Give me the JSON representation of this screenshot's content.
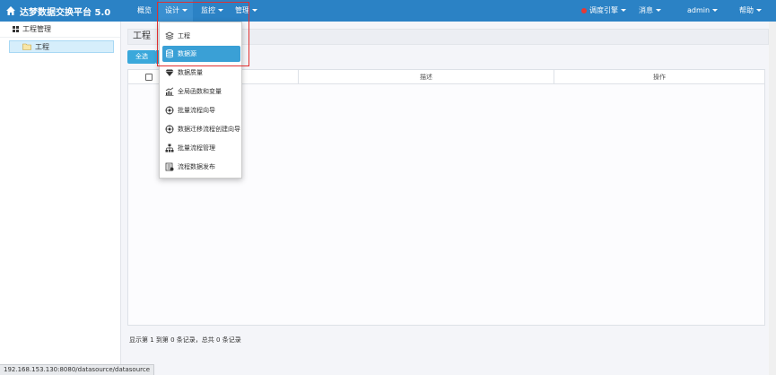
{
  "app": {
    "title": "达梦数据交换平台 5.0"
  },
  "nav": {
    "overview": "概览",
    "design": "设计",
    "monitor": "监控",
    "manage": "管理",
    "engine": "调度引擎",
    "messages": "消息",
    "user": "admin",
    "help": "帮助"
  },
  "sidebar": {
    "header": "工程管理",
    "items": [
      {
        "label": "工程"
      }
    ]
  },
  "main": {
    "title": "工程",
    "select_all": "全选",
    "columns": {
      "col2": "描述",
      "col3": "操作"
    },
    "footer": "显示第 1 到第 0 条记录，总共 0 条记录"
  },
  "dropdown": {
    "items": [
      {
        "label": "工程",
        "icon": "layers-icon"
      },
      {
        "label": "数据源",
        "icon": "database-icon"
      },
      {
        "label": "数据质量",
        "icon": "diamond-icon"
      },
      {
        "label": "全局函数和变量",
        "icon": "chart-fx-icon"
      },
      {
        "label": "批量流程向导",
        "icon": "wizard-icon"
      },
      {
        "label": "数据迁移流程创建向导",
        "icon": "migrate-wizard-icon"
      },
      {
        "label": "批量流程管理",
        "icon": "hierarchy-icon"
      },
      {
        "label": "流程数据发布",
        "icon": "publish-icon"
      }
    ]
  },
  "statusbar": {
    "url": "192.168.153.130:8080/datasource/datasource"
  },
  "colors": {
    "nav": "#2b82c5",
    "accent": "#3aa0d6",
    "highlight": "#e03030"
  }
}
